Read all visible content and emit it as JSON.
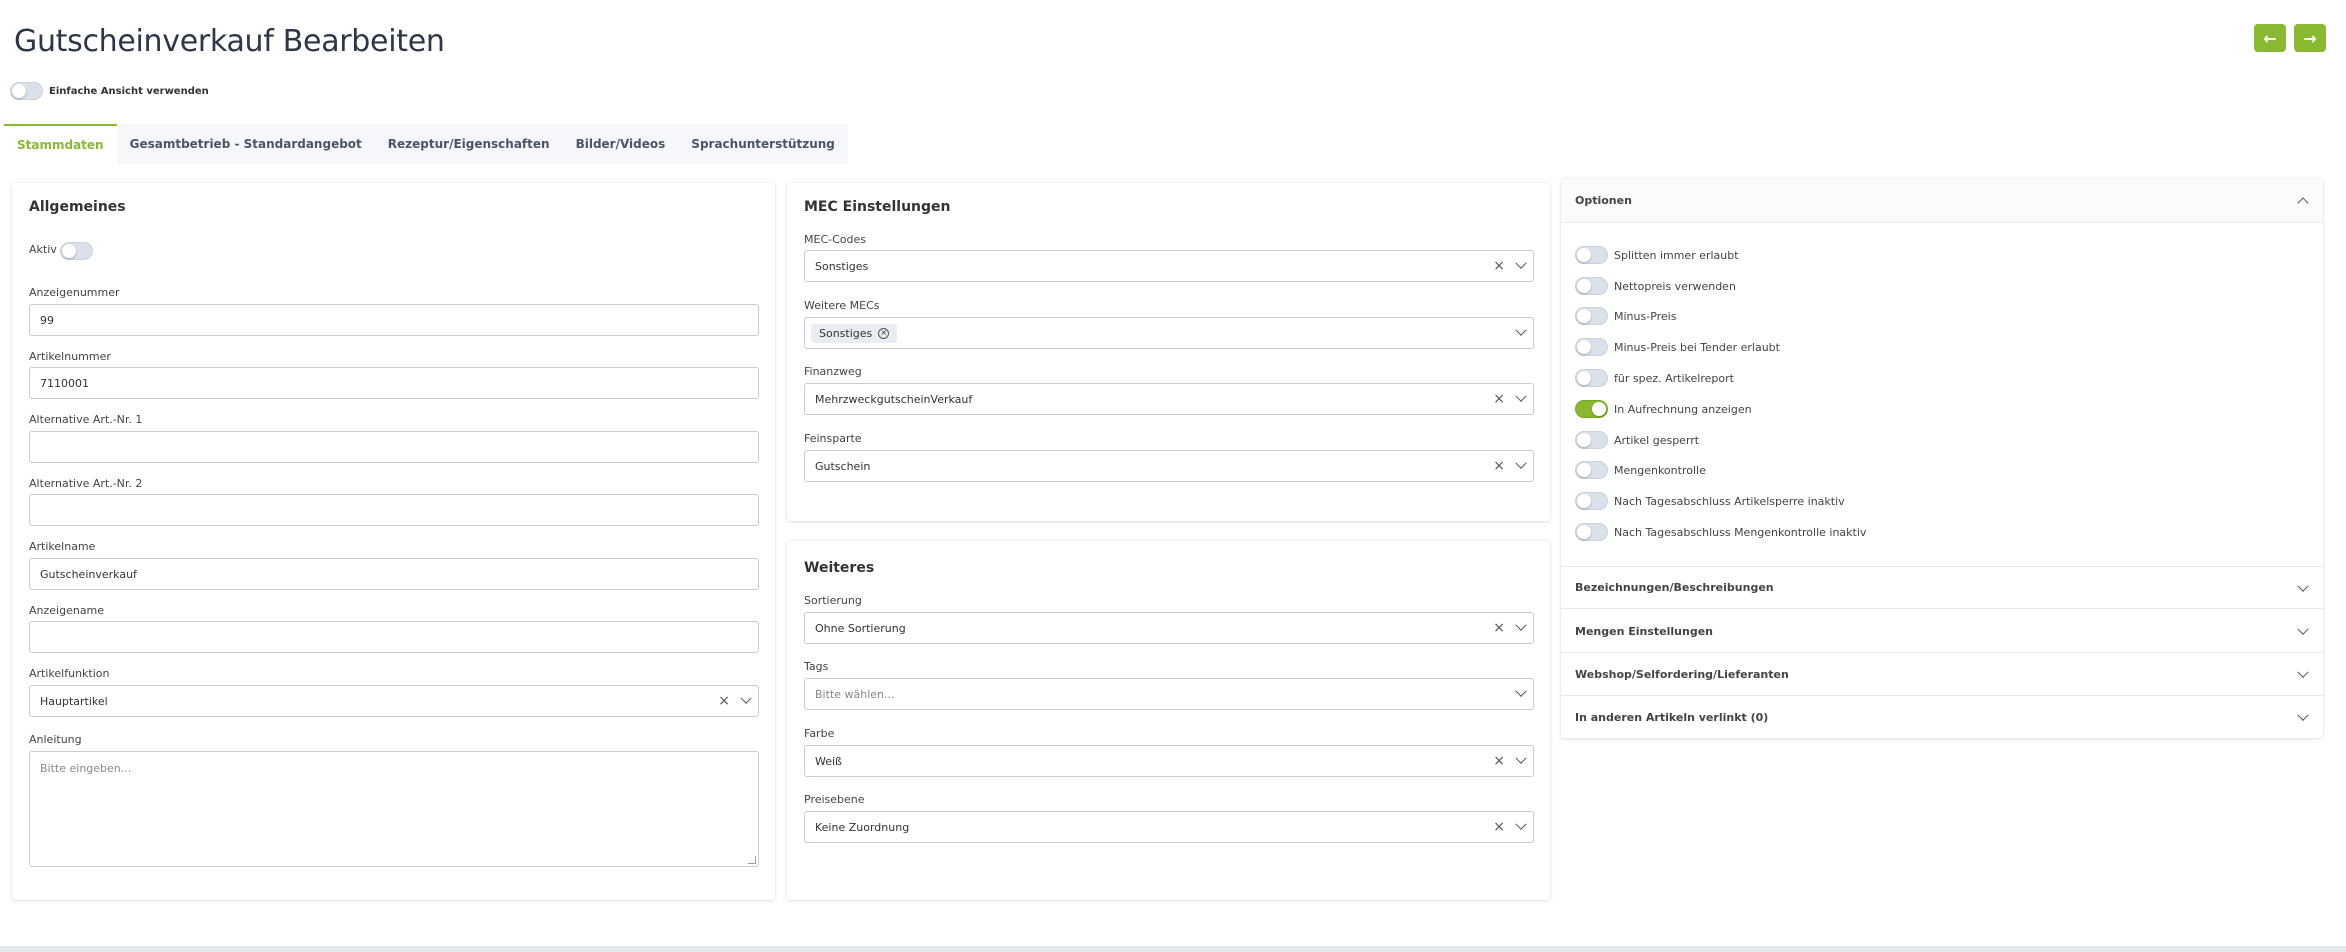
{
  "page": {
    "title": "Gutscheinverkauf Bearbeiten",
    "accent_color": "#8ab832"
  },
  "simple_view": {
    "label": "Einfache Ansicht verwenden"
  },
  "tabs": [
    {
      "label": "Stammdaten"
    },
    {
      "label": "Gesamtbetrieb - Standardangebot"
    },
    {
      "label": "Rezeptur/Eigenschaften"
    },
    {
      "label": "Bilder/Videos"
    },
    {
      "label": "Sprachunterstützung"
    }
  ],
  "allgemeines": {
    "title": "Allgemeines",
    "aktiv_label": "Aktiv",
    "anzeigenummer": {
      "label": "Anzeigenummer",
      "value": "99"
    },
    "artikelnummer": {
      "label": "Artikelnummer",
      "value": "7110001"
    },
    "alt1": {
      "label": "Alternative Art.-Nr. 1",
      "value": ""
    },
    "alt2": {
      "label": "Alternative Art.-Nr. 2",
      "value": ""
    },
    "artikelname": {
      "label": "Artikelname",
      "value": "Gutscheinverkauf"
    },
    "anzeigename": {
      "label": "Anzeigename",
      "value": ""
    },
    "artikelfunktion": {
      "label": "Artikelfunktion",
      "value": "Hauptartikel"
    },
    "anleitung": {
      "label": "Anleitung",
      "placeholder": "Bitte eingeben..."
    }
  },
  "mec": {
    "title": "MEC Einstellungen",
    "mec_codes": {
      "label": "MEC-Codes",
      "value": "Sonstiges"
    },
    "weitere_mecs": {
      "label": "Weitere MECs",
      "chip": "Sonstiges"
    },
    "finanzweg": {
      "label": "Finanzweg",
      "value": "MehrzweckgutscheinVerkauf"
    },
    "feinsparte": {
      "label": "Feinsparte",
      "value": "Gutschein"
    }
  },
  "weiteres": {
    "title": "Weiteres",
    "sortierung": {
      "label": "Sortierung",
      "value": "Ohne Sortierung"
    },
    "tags": {
      "label": "Tags",
      "placeholder": "Bitte wählen..."
    },
    "farbe": {
      "label": "Farbe",
      "value": "Weiß"
    },
    "preisebene": {
      "label": "Preisebene",
      "value": "Keine Zuordnung"
    }
  },
  "optionen": {
    "title": "Optionen",
    "items": [
      {
        "label": "Splitten immer erlaubt",
        "on": false
      },
      {
        "label": "Nettopreis verwenden",
        "on": false
      },
      {
        "label": "Minus-Preis",
        "on": false
      },
      {
        "label": "Minus-Preis bei Tender erlaubt",
        "on": false
      },
      {
        "label": "für spez. Artikelreport",
        "on": false
      },
      {
        "label": "In Aufrechnung anzeigen",
        "on": true
      },
      {
        "label": "Artikel gesperrt",
        "on": false
      },
      {
        "label": "Mengenkontrolle",
        "on": false
      },
      {
        "label": "Nach Tagesabschluss Artikelsperre inaktiv",
        "on": false
      },
      {
        "label": "Nach Tagesabschluss Mengenkontrolle inaktiv",
        "on": false
      }
    ]
  },
  "accordion": [
    {
      "label": "Bezeichnungen/Beschreibungen"
    },
    {
      "label": "Mengen Einstellungen"
    },
    {
      "label": "Webshop/Selfordering/Lieferanten"
    },
    {
      "label": "In anderen Artikeln verlinkt (0)"
    }
  ]
}
